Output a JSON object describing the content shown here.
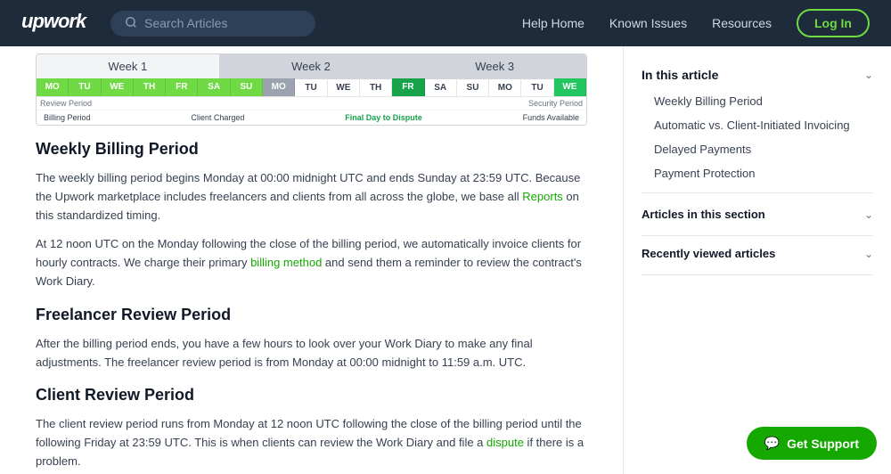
{
  "header": {
    "logo_text": "upwork",
    "search_placeholder": "Search Articles",
    "nav": {
      "help_home": "Help Home",
      "known_issues": "Known Issues",
      "resources": "Resources",
      "login": "Log In"
    }
  },
  "calendar": {
    "weeks": [
      "Week 1",
      "Week 2",
      "Week 3"
    ],
    "days_w1": [
      "MO",
      "TU",
      "WE",
      "TH",
      "FR",
      "SA",
      "SU"
    ],
    "days_w2": [
      "MO",
      "TU",
      "WE",
      "TH",
      "FR",
      "SA",
      "SU"
    ],
    "days_w3": [
      "MO",
      "TU",
      "WE"
    ],
    "labels": {
      "billing_period": "Billing Period",
      "client_charged": "Client Charged",
      "final_day_to_dispute": "Final Day to Dispute",
      "funds_available": "Funds Available",
      "review_period": "Review Period",
      "security_period": "Security Period"
    }
  },
  "article": {
    "weekly_billing_period": {
      "title": "Weekly Billing Period",
      "para1": "The weekly billing period begins Monday at 00:00 midnight UTC and ends Sunday at 23:59 UTC. Because the Upwork marketplace includes freelancers and clients from all across the globe, we base all ",
      "reports_link": "Reports",
      "para1_end": " on this standardized timing.",
      "para2": "At 12 noon UTC on the Monday following the close of the billing period, we automatically invoice clients for hourly contracts. We charge their primary ",
      "billing_method_link": "billing method",
      "para2_end": " and send them a reminder to review the contract's Work Diary."
    },
    "freelancer_review": {
      "title": "Freelancer Review Period",
      "para": "After the billing period ends, you have a few hours to look over your Work Diary to make any final adjustments. The freelancer review period is from Monday at 00:00 midnight to 11:59 a.m. UTC."
    },
    "client_review": {
      "title": "Client Review Period",
      "para1": "The client review period runs from Monday at 12 noon UTC following the close of the billing period until the following Friday at 23:59 UTC. This is when clients can review the Work Diary and file a ",
      "dispute_link": "dispute",
      "para1_end": " if there is a problem."
    }
  },
  "sidebar": {
    "in_this_article_title": "In this article",
    "toc_items": [
      "Weekly Billing Period",
      "Automatic vs. Client-Initiated Invoicing",
      "Delayed Payments",
      "Payment Protection"
    ],
    "articles_section_title": "Articles in this section",
    "recently_viewed_title": "Recently viewed articles"
  },
  "support_btn": "Get Support"
}
